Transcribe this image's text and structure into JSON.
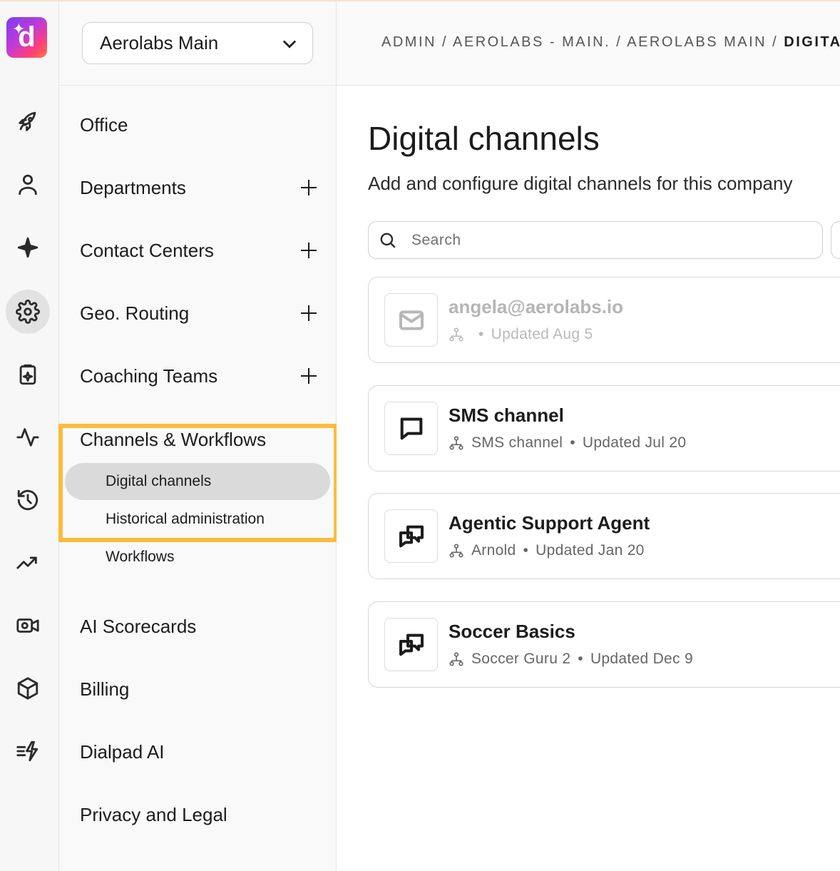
{
  "app": {
    "logo_letter": "d"
  },
  "rail": {
    "icons": [
      "rocket-icon",
      "person-icon",
      "sparkle-icon",
      "gear-icon",
      "clipboard-icon",
      "activity-icon",
      "history-icon",
      "trending-icon",
      "video-settings-icon",
      "cube-icon",
      "ai-lightning-icon"
    ],
    "active": "gear-icon"
  },
  "nav": {
    "org_selector": "Aerolabs Main",
    "items": [
      {
        "label": "Office"
      },
      {
        "label": "Departments"
      },
      {
        "label": "Contact Centers"
      },
      {
        "label": "Geo. Routing"
      },
      {
        "label": "Coaching Teams"
      },
      {
        "label": "Channels & Workflows"
      },
      {
        "label": "AI Scorecards"
      },
      {
        "label": "Billing"
      },
      {
        "label": "Dialpad AI"
      },
      {
        "label": "Privacy and Legal"
      }
    ],
    "subitems": [
      {
        "label": "Digital channels",
        "active": true
      },
      {
        "label": "Historical administration"
      },
      {
        "label": "Workflows"
      }
    ]
  },
  "header": {
    "breadcrumb": "ADMIN / AEROLABS - MAIN. / AEROLABS MAIN / ",
    "breadcrumb_current": "DIGITA"
  },
  "main": {
    "title": "Digital channels",
    "subtitle": "Add and configure digital channels for this company",
    "search_placeholder": "Search",
    "channels": [
      {
        "name": "angela@aerolabs.io",
        "owner": "",
        "updated": "Updated Aug 5",
        "icon": "mail-icon",
        "disabled": true
      },
      {
        "name": "SMS channel",
        "owner": "SMS channel",
        "updated": "Updated Jul 20",
        "icon": "message-icon",
        "disabled": false
      },
      {
        "name": "Agentic Support Agent",
        "owner": "Arnold",
        "updated": "Updated Jan 20",
        "icon": "chat-bubbles-icon",
        "disabled": false
      },
      {
        "name": "Soccer Basics",
        "owner": "Soccer Guru 2",
        "updated": "Updated Dec 9",
        "icon": "chat-bubbles-icon",
        "disabled": false
      }
    ]
  },
  "colors": {
    "highlight": "#fbbc3c",
    "active_bg": "#dadada"
  }
}
